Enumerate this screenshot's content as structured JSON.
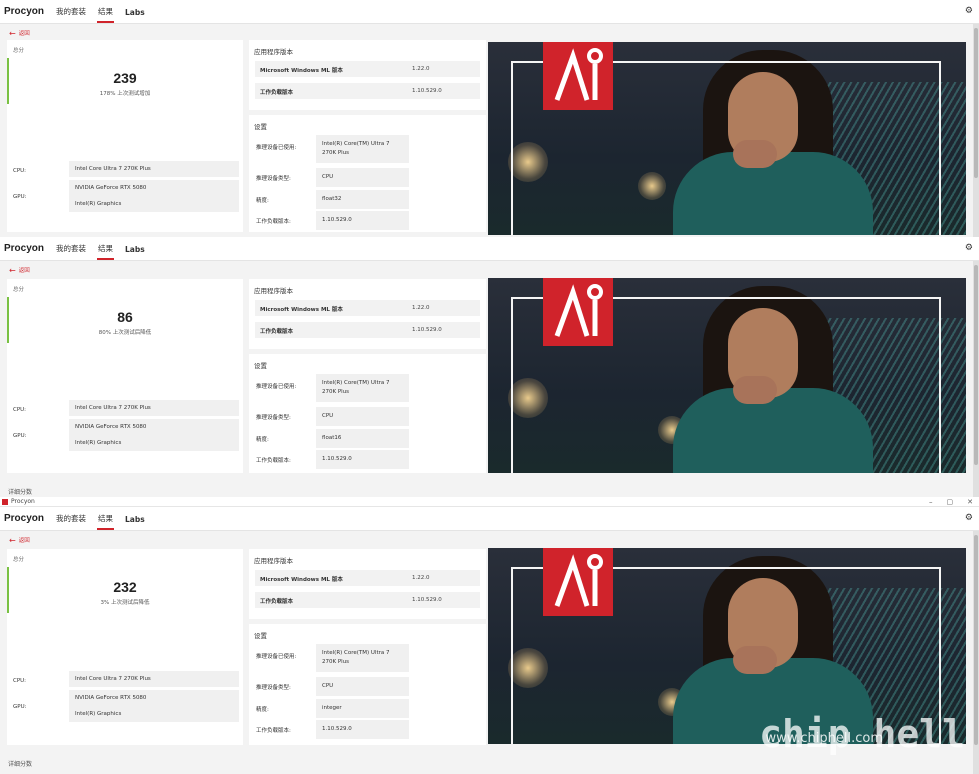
{
  "window": {
    "title": "Procyon",
    "controls": [
      "–",
      "▢",
      "✕"
    ]
  },
  "nav": {
    "brand": "Procyon",
    "tabs": [
      {
        "label": "我的套装"
      },
      {
        "label": "结果"
      },
      {
        "label": "Labs"
      }
    ],
    "settings_icon": "gear-icon"
  },
  "back_label": "返回",
  "score_label": "总分",
  "detail_label": "详细分数",
  "version_card": {
    "title": "应用程序版本",
    "rows": [
      {
        "key": "Microsoft Windows ML 版本",
        "value": "1.22.0"
      },
      {
        "key": "工作负载版本",
        "value": "1.10.529.0"
      }
    ]
  },
  "settings_card_title": "设置",
  "settings_keys": [
    "推理设备已使用:",
    "推理设备类型:",
    "精度:",
    "工作负载版本:"
  ],
  "hardware": {
    "cpu_label": "CPU:",
    "gpu_label": "GPU:",
    "cpu": "Intel Core Ultra 7 270K Plus",
    "gpu": [
      "NVIDIA GeForce RTX 5080",
      "Intel(R) Graphics"
    ]
  },
  "results": [
    {
      "score": "239",
      "delta": "178% 上次测试增加",
      "settings": [
        "Intel(R) Core(TM) Ultra 7 270K Plus",
        "CPU",
        "float32",
        "1.10.529.0"
      ]
    },
    {
      "score": "86",
      "delta": "80% 上次测试后降低",
      "settings": [
        "Intel(R) Core(TM) Ultra 7 270K Plus",
        "CPU",
        "float16",
        "1.10.529.0"
      ]
    },
    {
      "score": "232",
      "delta": "3% 上次测试后降低",
      "settings": [
        "Intel(R) Core(TM) Ultra 7 270K Plus",
        "CPU",
        "integer",
        "1.10.529.0"
      ]
    }
  ],
  "watermark": {
    "url": "www.chiphell.com",
    "mark": "chip hell"
  },
  "colors": {
    "accent": "#d0232b",
    "score_bar": "#7ac143",
    "panel_bg": "#ffffff",
    "page_bg": "#f3f3f3"
  }
}
